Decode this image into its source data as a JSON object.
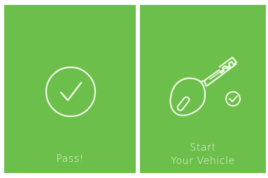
{
  "colors": {
    "panel_background": "#6cbf4a",
    "icon_stroke": "#f1faea",
    "caption_text": "#eaf7e2"
  },
  "screens": [
    {
      "icon": "check-circle-icon",
      "caption": "Pass!"
    },
    {
      "icon": "car-key-icon",
      "badge_icon": "check-circle-small-icon",
      "caption_line1": "Start",
      "caption_line2": "Your Vehicle"
    }
  ]
}
